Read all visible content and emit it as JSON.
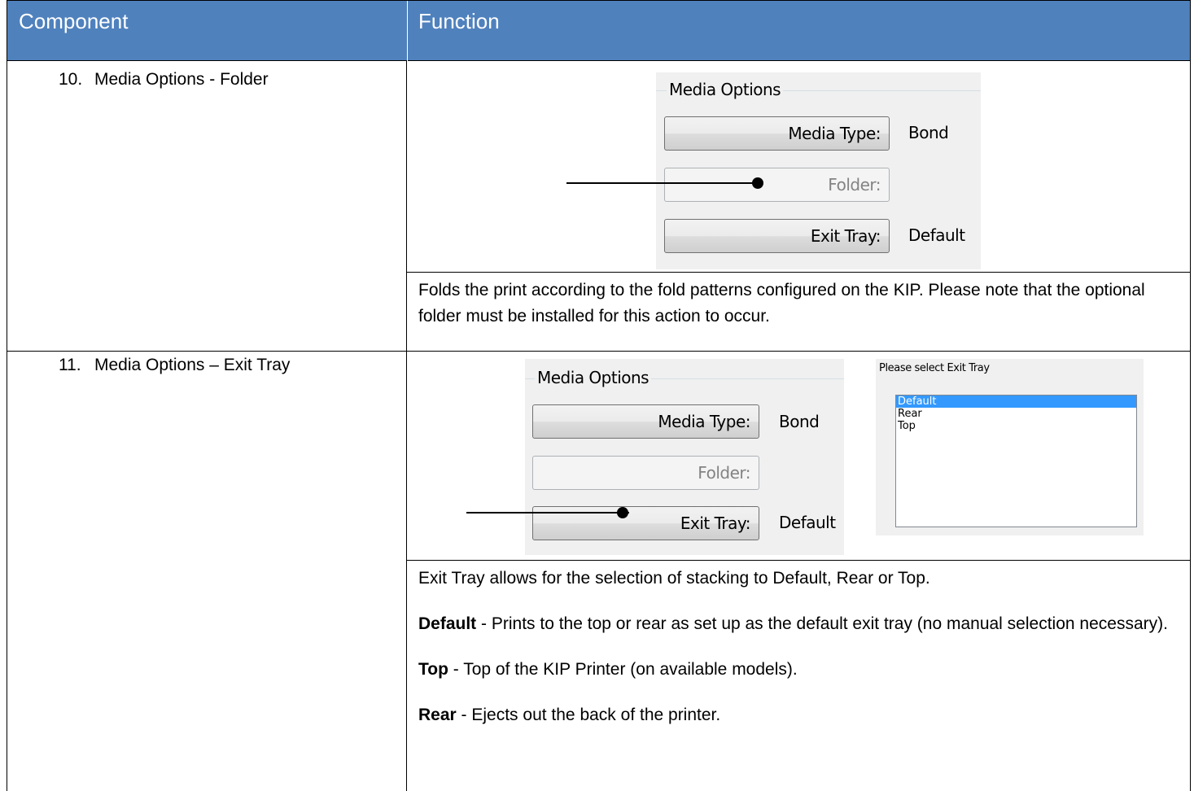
{
  "header": {
    "col1": "Component",
    "col2": "Function"
  },
  "rows": [
    {
      "num": "10.",
      "component": "Media Options - Folder",
      "screenshot": {
        "group_title": "Media Options",
        "media_type_label": "Media Type:",
        "media_type_value": "Bond",
        "folder_label": "Folder:",
        "exit_tray_label": "Exit Tray:",
        "exit_tray_value": "Default"
      },
      "description": "Folds the print according to the fold patterns configured on the KIP. Please note that the optional folder must be installed for this action to occur."
    },
    {
      "num": "11.",
      "component": "Media Options – Exit Tray",
      "screenshot": {
        "group_title": "Media Options",
        "media_type_label": "Media Type:",
        "media_type_value": "Bond",
        "folder_label": "Folder:",
        "exit_tray_label": "Exit Tray:",
        "exit_tray_value": "Default",
        "select_title": "Please select Exit Tray",
        "options": [
          "Default",
          "Rear",
          "Top"
        ],
        "selected_option": "Default"
      },
      "intro": "Exit Tray allows for the selection of stacking to Default, Rear or Top.",
      "items": [
        {
          "term": "Default",
          "text": " - Prints to the top or rear as set up as the default exit tray (no manual selection necessary)."
        },
        {
          "term": "Top",
          "text": " - Top of the KIP Printer (on available models)."
        },
        {
          "term": "Rear",
          "text": " - Ejects out the back of the printer."
        }
      ]
    }
  ]
}
